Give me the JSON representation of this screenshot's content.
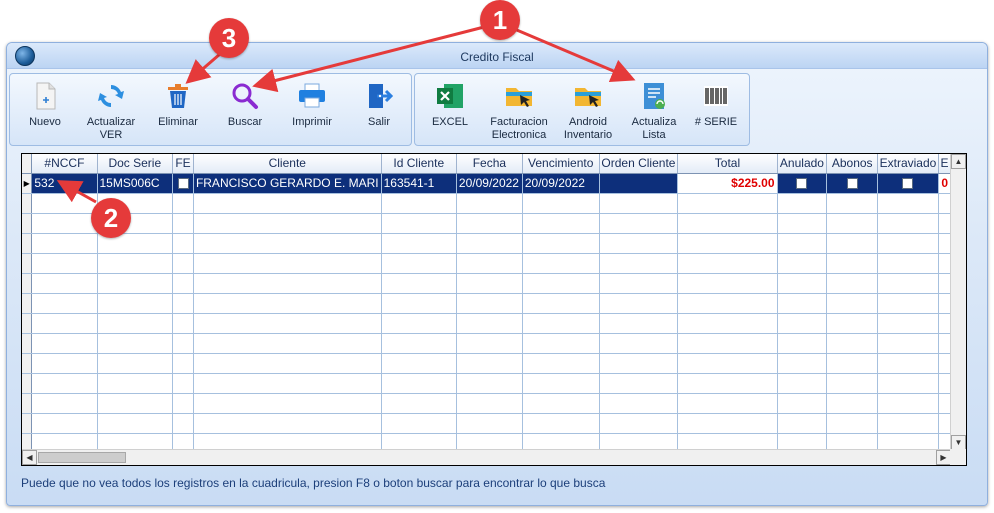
{
  "window": {
    "title": "Credito Fiscal"
  },
  "toolbar": {
    "left": [
      {
        "id": "nuevo",
        "label": "Nuevo",
        "icon": "new-document-icon"
      },
      {
        "id": "actualizar",
        "label": "Actualizar\nVER",
        "icon": "refresh-icon"
      },
      {
        "id": "eliminar",
        "label": "Eliminar",
        "icon": "trash-icon"
      },
      {
        "id": "buscar",
        "label": "Buscar",
        "icon": "magnifier-icon"
      },
      {
        "id": "imprimir",
        "label": "Imprimir",
        "icon": "printer-icon"
      },
      {
        "id": "salir",
        "label": "Salir",
        "icon": "exit-door-icon"
      }
    ],
    "right": [
      {
        "id": "excel",
        "label": "EXCEL",
        "icon": "excel-icon"
      },
      {
        "id": "facturacion",
        "label": "Facturacion\nElectronica",
        "icon": "folder-cursor-icon"
      },
      {
        "id": "android",
        "label": "Android\nInventario",
        "icon": "folder-cursor-icon"
      },
      {
        "id": "actualiza-lista",
        "label": "Actualiza\nLista",
        "icon": "list-refresh-icon"
      },
      {
        "id": "serie",
        "label": "# SERIE",
        "icon": "barcode-icon"
      }
    ]
  },
  "grid": {
    "columns": [
      "#NCCF",
      "Doc Serie",
      "FE",
      "Cliente",
      "Id Cliente",
      "Fecha",
      "Vencimiento",
      "Orden Cliente",
      "Total",
      "Anulado",
      "Abonos",
      "Extraviado",
      "E"
    ],
    "rows": [
      {
        "nccf": "532",
        "doc_serie": "15MS006C",
        "cliente": "FRANCISCO GERARDO E. MARI",
        "id_cliente": "163541-1",
        "fecha": "20/09/2022",
        "vencimiento": "20/09/2022",
        "orden_cliente": "",
        "total": "$225.00",
        "e": "0"
      }
    ]
  },
  "status": {
    "message": "Puede que no vea todos los registros en la cuadricula, presion F8 o boton buscar para encontrar lo que busca"
  },
  "callouts": [
    "1",
    "2",
    "3"
  ],
  "colors": {
    "callout": "#e53a3a",
    "selection": "#0d2f7b",
    "total_text": "#e00000"
  }
}
